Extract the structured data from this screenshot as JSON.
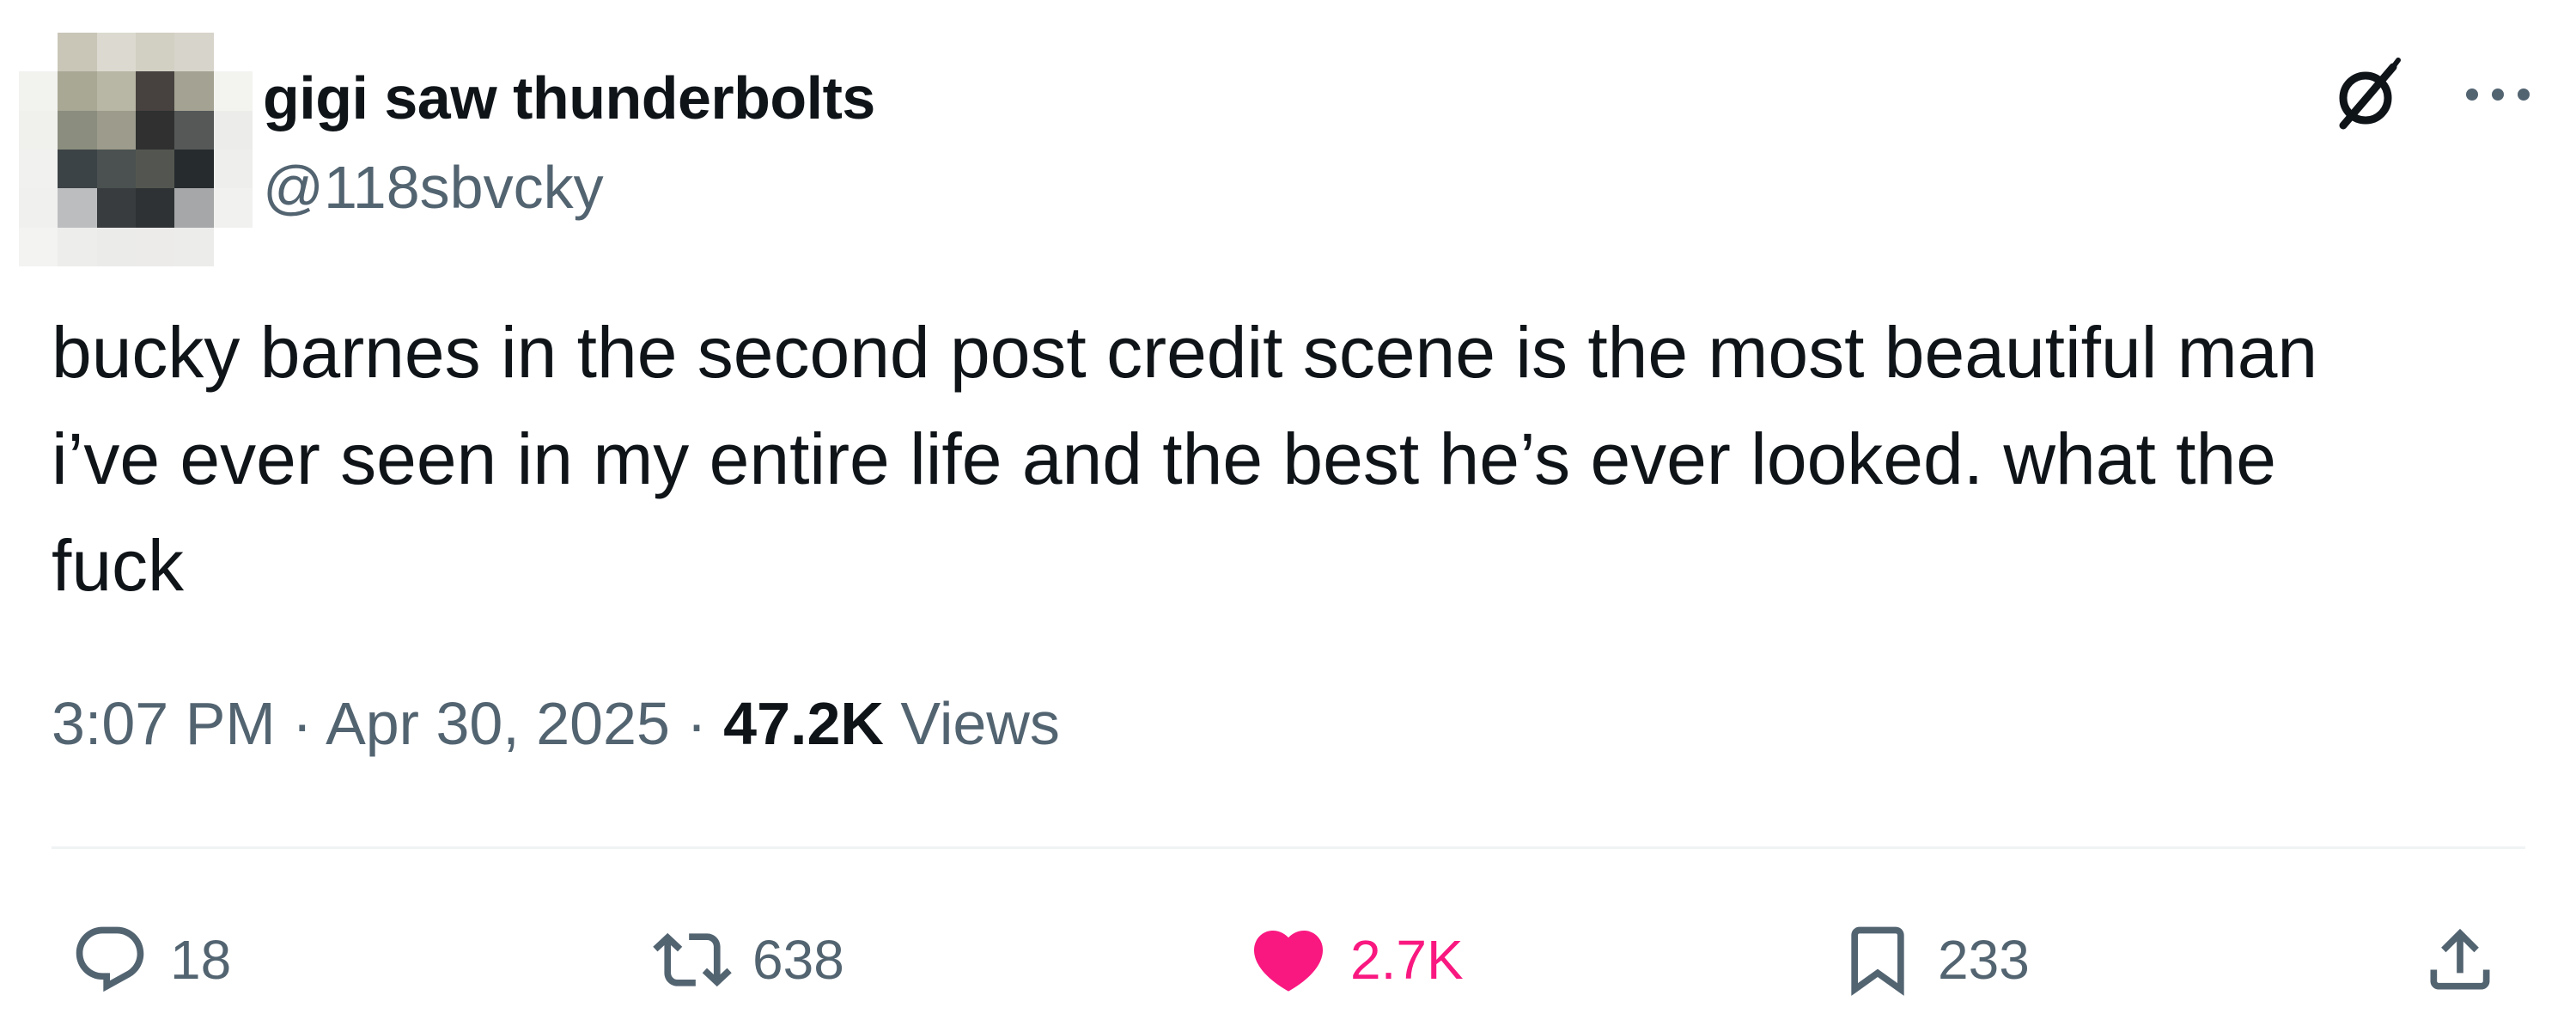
{
  "author": {
    "display_name": "gigi saw thunderbolts",
    "handle": "@118sbvcky"
  },
  "header_icons": [
    "grok-icon",
    "more-options-icon"
  ],
  "post": {
    "text": "bucky barnes in the second post credit scene is the most beautiful man\ni’ve ever seen in my entire life and the best he’s ever looked. what the\nfuck",
    "time": "3:07 PM",
    "date": "Apr 30, 2025",
    "separator": "·",
    "views_count": "47.2K",
    "views_label": "Views"
  },
  "actions": {
    "reply": {
      "icon": "reply-icon",
      "count": "18"
    },
    "repost": {
      "icon": "repost-icon",
      "count": "638"
    },
    "like": {
      "icon": "heart-icon",
      "count": "2.7K",
      "active": true,
      "active_color": "#f91880"
    },
    "bookmark": {
      "icon": "bookmark-icon",
      "count": "233"
    },
    "share": {
      "icon": "share-icon"
    }
  },
  "colors": {
    "text_primary": "#0f1419",
    "text_secondary": "#536471",
    "like_pink": "#f91880",
    "divider": "#eff3f4"
  }
}
